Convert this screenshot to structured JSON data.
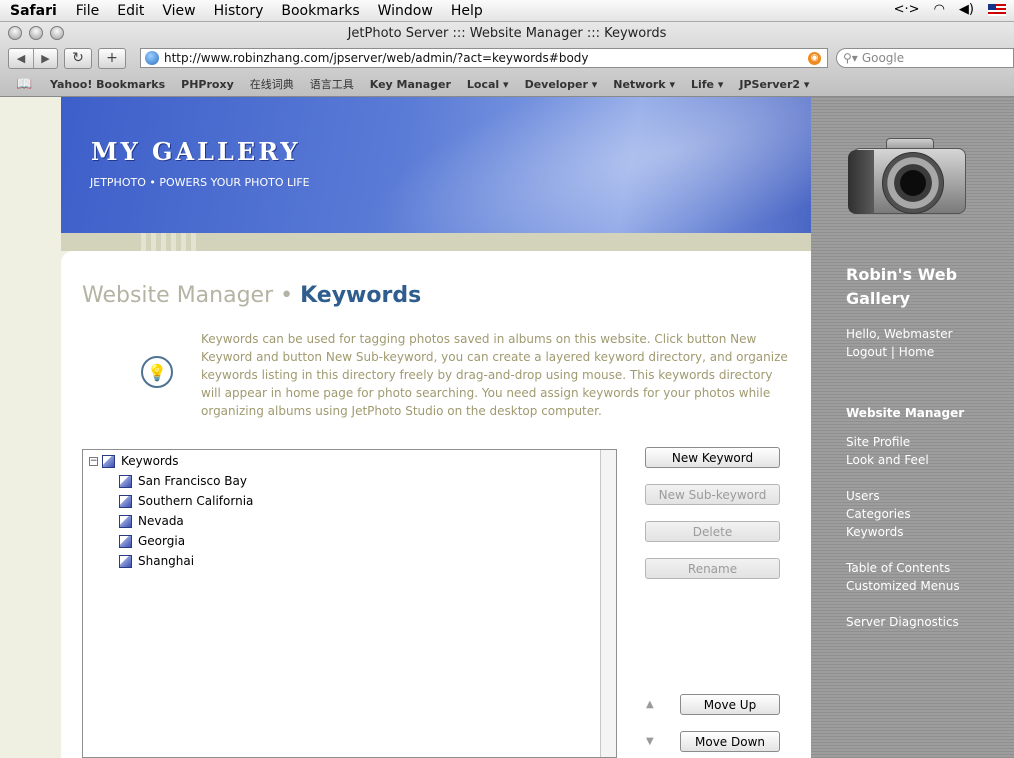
{
  "menubar": {
    "app": "Safari",
    "items": [
      "File",
      "Edit",
      "View",
      "History",
      "Bookmarks",
      "Window",
      "Help"
    ]
  },
  "window": {
    "title": "JetPhoto Server ::: Website Manager ::: Keywords",
    "url": "http://www.robinzhang.com/jpserver/web/admin/?act=keywords#body",
    "search_placeholder": "Google"
  },
  "bookmarks": [
    "Yahoo! Bookmarks",
    "PHProxy",
    "在线词典",
    "语言工具",
    "Key Manager",
    "Local ▾",
    "Developer ▾",
    "Network ▾",
    "Life ▾",
    "JPServer2 ▾"
  ],
  "banner": {
    "title": "MY GALLERY",
    "subtitle": "JETPHOTO • POWERS YOUR PHOTO LIFE"
  },
  "heading": {
    "section": "Website Manager",
    "separator": "•",
    "page": "Keywords"
  },
  "description": "Keywords can be used for tagging photos saved in albums on this website. Click button New Keyword and button New Sub-keyword, you can create a layered keyword directory, and organize keywords listing in this directory freely by drag-and-drop using mouse. This keywords directory will appear in home page for photo searching. You need assign keywords for your photos while organizing albums using JetPhoto Studio on the desktop computer.",
  "tree": {
    "root": "Keywords",
    "root_toggle": "−",
    "children": [
      "San Francisco Bay",
      "Southern California",
      "Nevada",
      "Georgia",
      "Shanghai"
    ]
  },
  "buttons": {
    "new_keyword": "New Keyword",
    "new_sub_keyword": "New Sub-keyword",
    "delete": "Delete",
    "rename": "Rename",
    "move_up": "Move Up",
    "move_down": "Move Down"
  },
  "sidebar": {
    "site_title": "Robin's Web Gallery",
    "greeting": "Hello, Webmaster",
    "logout": "Logout",
    "link_sep": "|",
    "home": "Home",
    "section": "Website Manager",
    "links": [
      "Site Profile",
      "Look and Feel",
      "Users",
      "Categories",
      "Keywords",
      "Table of Contents",
      "Customized Menus",
      "Server Diagnostics"
    ]
  }
}
